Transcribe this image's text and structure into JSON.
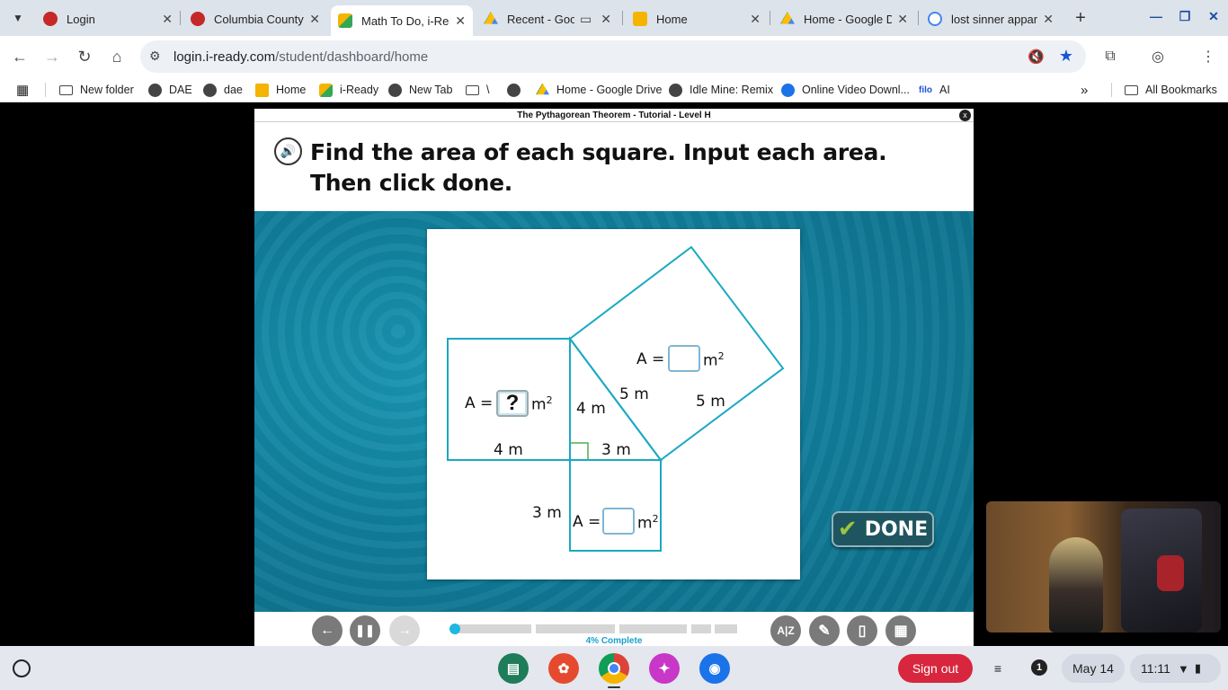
{
  "tabs": [
    {
      "title": "Login",
      "color": "#c62828"
    },
    {
      "title": "Columbia County",
      "color": "#c62828"
    },
    {
      "title": "Math To Do, i-Ready",
      "color": "#f4b400",
      "active": true
    },
    {
      "title": "Recent - Google",
      "color": "#1e8e3e"
    },
    {
      "title": "Home",
      "color": "#f4b400"
    },
    {
      "title": "Home - Google Drive",
      "color": "#1e8e3e"
    },
    {
      "title": "lost sinner apparel",
      "color": "#4285f4"
    }
  ],
  "address": {
    "host": "login.i-ready.com",
    "path": "/student/dashboard/home"
  },
  "bookmarks": [
    {
      "label": "New folder",
      "icon": "folder"
    },
    {
      "label": "DAE",
      "icon": "globe"
    },
    {
      "label": "dae",
      "icon": "globe"
    },
    {
      "label": "Home",
      "icon": "classroom"
    },
    {
      "label": "i-Ready",
      "icon": "iready"
    },
    {
      "label": "New Tab",
      "icon": "globe"
    },
    {
      "label": "\\",
      "icon": "folder"
    },
    {
      "label": "",
      "icon": "globe"
    },
    {
      "label": "Home - Google Drive",
      "icon": "drive"
    },
    {
      "label": "Idle Mine: Remix",
      "icon": "globe"
    },
    {
      "label": "Online Video Downl...",
      "icon": "cloud"
    },
    {
      "label": "AI",
      "icon": "filo"
    },
    {
      "label": "All Bookmarks",
      "icon": "folder"
    }
  ],
  "bookmark_filo_text": "filo",
  "lesson": {
    "header": "The Pythagorean Theorem - Tutorial - Level H",
    "close": "x",
    "instruction_line1": "Find the area of each square. Input each area.",
    "instruction_line2": "Then click done.",
    "figure": {
      "area_prefix": "A =",
      "unit": "m",
      "unit_exp": "2",
      "left_square_value": "?",
      "left_side": "4 m",
      "left_leg": "4 m",
      "bottom_leg": "3 m",
      "bottom_side": "3 m",
      "hyp_label": "5 m",
      "hyp_side": "5 m"
    },
    "done_label": "DONE",
    "progress_percent": 4,
    "progress_text": "4% Complete"
  },
  "shelf": {
    "sign_out": "Sign out",
    "notifications": "1",
    "date": "May 14",
    "time": "11:11"
  }
}
